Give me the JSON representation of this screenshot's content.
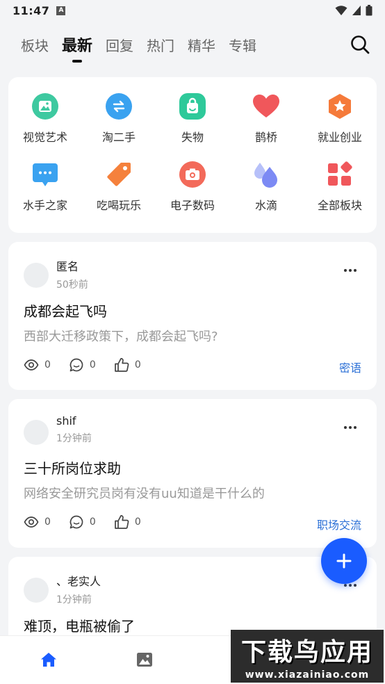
{
  "status_bar": {
    "time": "11:47",
    "notif_glyph": "A"
  },
  "tabs": [
    {
      "label": "板块",
      "active": false
    },
    {
      "label": "最新",
      "active": true
    },
    {
      "label": "回复",
      "active": false
    },
    {
      "label": "热门",
      "active": false
    },
    {
      "label": "精华",
      "active": false
    },
    {
      "label": "专辑",
      "active": false
    }
  ],
  "categories": [
    {
      "label": "视觉艺术",
      "icon": "image-icon",
      "color": "#3ec9a0"
    },
    {
      "label": "淘二手",
      "icon": "exchange-icon",
      "color": "#3aa2f0"
    },
    {
      "label": "失物",
      "icon": "bag-icon",
      "color": "#2ec99a"
    },
    {
      "label": "鹊桥",
      "icon": "heart-icon",
      "color": "#f0575b"
    },
    {
      "label": "就业创业",
      "icon": "star-badge-icon",
      "color": "#f57a3a"
    },
    {
      "label": "水手之家",
      "icon": "chat-bubble-icon",
      "color": "#3aa2f0"
    },
    {
      "label": "吃喝玩乐",
      "icon": "tag-icon",
      "color": "#f5813c"
    },
    {
      "label": "电子数码",
      "icon": "camera-icon",
      "color": "#f36a5a"
    },
    {
      "label": "水滴",
      "icon": "drops-icon",
      "color": "#7c8af4"
    },
    {
      "label": "全部板块",
      "icon": "grid-icon",
      "color": "#f0575b"
    }
  ],
  "posts": [
    {
      "author": "匿名",
      "time": "50秒前",
      "title": "成都会起飞吗",
      "desc": "西部大迁移政策下，成都会起飞吗?",
      "views": "0",
      "comments": "0",
      "likes": "0",
      "tag": "密语"
    },
    {
      "author": "shif",
      "time": "1分钟前",
      "title": "三十所岗位求助",
      "desc": "网络安全研究员岗有没有uu知道是干什么的",
      "views": "0",
      "comments": "0",
      "likes": "0",
      "tag": "职场交流"
    },
    {
      "author": "、老实人",
      "time": "1分钟前",
      "title": "难顶，电瓶被偷了",
      "desc": "",
      "views": "",
      "comments": "",
      "likes": "",
      "tag": ""
    }
  ],
  "watermark": {
    "main": "下载鸟应用",
    "url": "www.xiazainiao.com"
  },
  "colors": {
    "accent": "#1a5cff",
    "tag": "#2a6fd6",
    "nav_active": "#1a5cff"
  }
}
